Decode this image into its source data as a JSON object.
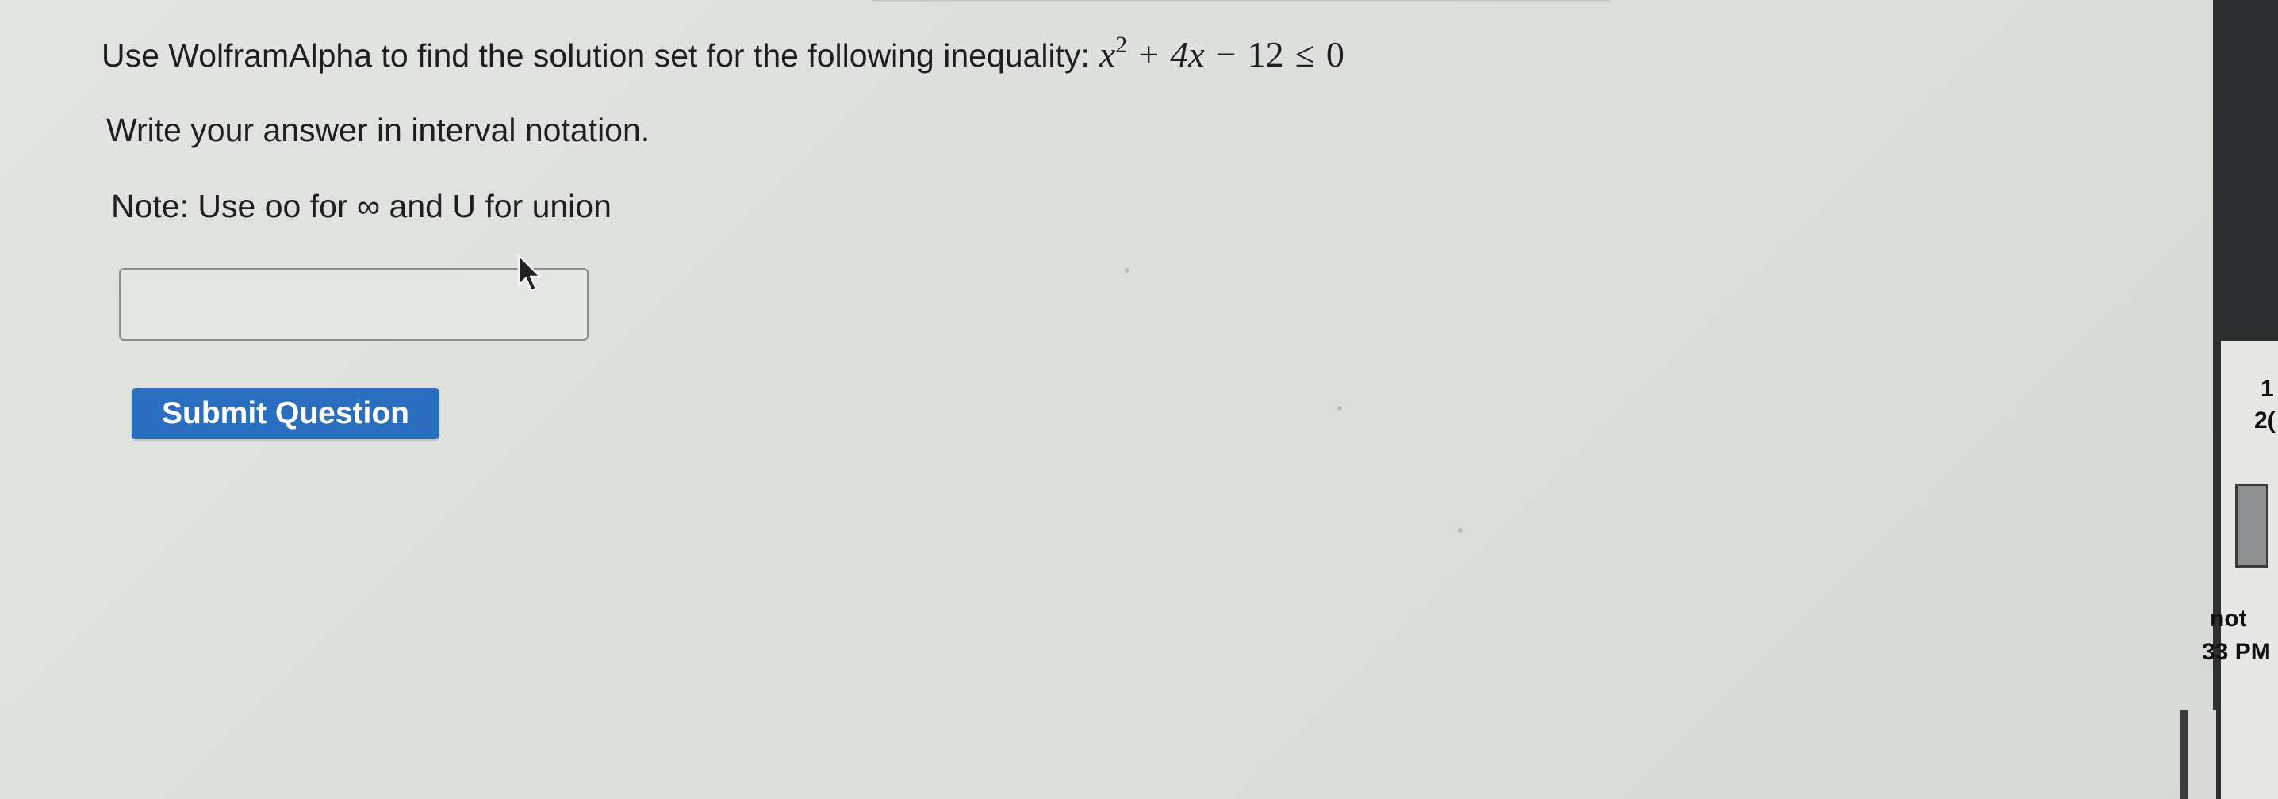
{
  "question": {
    "line1_text": "Use WolframAlpha to find the solution set for the following inequality:",
    "math": {
      "var1": "x",
      "exp": "2",
      "plus": "+",
      "term2": "4x",
      "minus": "−",
      "const": "12",
      "rel": "≤",
      "rhs": "0"
    },
    "line2_text": "Write your answer in interval notation.",
    "line3_text": "Note: Use oo for ∞ and U for union"
  },
  "answer": {
    "value": "",
    "placeholder": ""
  },
  "submit": {
    "label": "Submit Question"
  },
  "side": {
    "top_fragment_1": "1",
    "top_fragment_2": "2(",
    "bottom_fragment_1": "not",
    "bottom_fragment_2": "33 PM"
  },
  "colors": {
    "button_blue": "#2a6fbf",
    "background": "#dddfdc"
  },
  "icons": {
    "cursor": "mouse-pointer-icon"
  }
}
